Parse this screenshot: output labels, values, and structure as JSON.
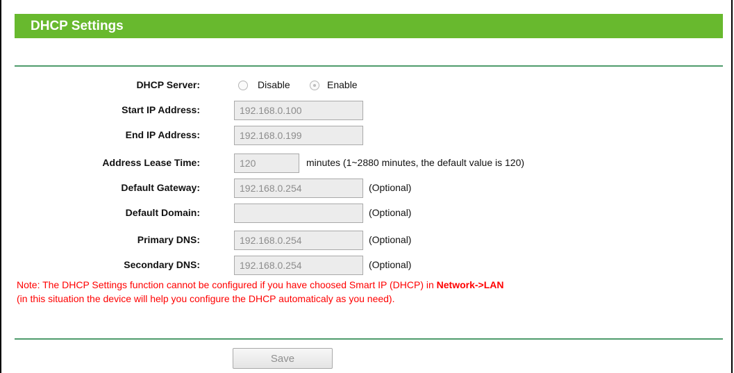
{
  "header": {
    "title": "DHCP Settings"
  },
  "form": {
    "dhcp_server": {
      "label": "DHCP Server:",
      "options": [
        "Disable",
        "Enable"
      ],
      "selected": "Enable"
    },
    "start_ip": {
      "label": "Start IP Address:",
      "value": "192.168.0.100"
    },
    "end_ip": {
      "label": "End IP Address:",
      "value": "192.168.0.199"
    },
    "lease_time": {
      "label": "Address Lease Time:",
      "value": "120",
      "hint": "minutes (1~2880 minutes, the default value is 120)"
    },
    "gateway": {
      "label": "Default Gateway:",
      "value": "192.168.0.254",
      "hint": "(Optional)"
    },
    "domain": {
      "label": "Default Domain:",
      "value": "",
      "hint": "(Optional)"
    },
    "primary_dns": {
      "label": "Primary DNS:",
      "value": "192.168.0.254",
      "hint": "(Optional)"
    },
    "secondary_dns": {
      "label": "Secondary DNS:",
      "value": "192.168.0.254",
      "hint": "(Optional)"
    }
  },
  "note": {
    "line1_prefix": "Note: The DHCP Settings function cannot be configured if you have choosed Smart IP (DHCP) in ",
    "line1_link": "Network->LAN",
    "line2": "(in this situation the device will help you configure the DHCP automaticaly as you need)."
  },
  "actions": {
    "save_label": "Save"
  },
  "colors": {
    "title_bar": "#68b92e",
    "divider": "#4e9b6b",
    "note_text": "#ff0000"
  }
}
